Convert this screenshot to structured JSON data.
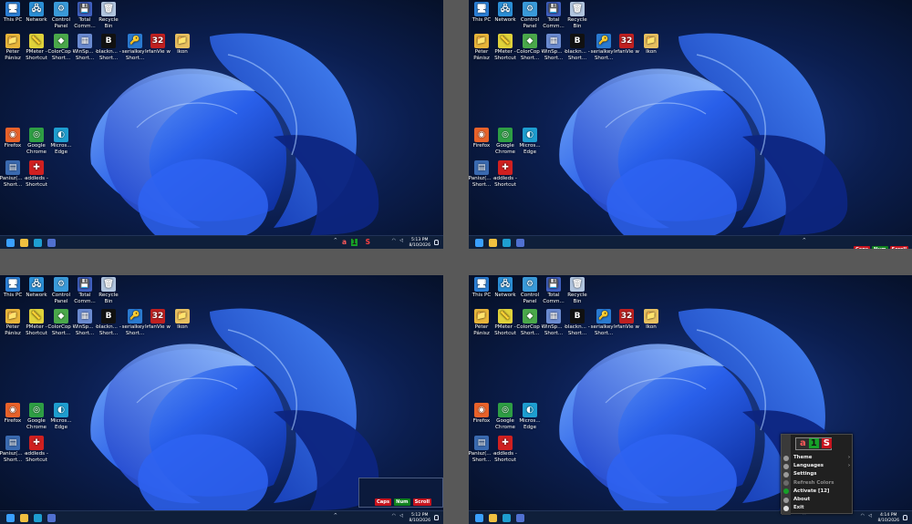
{
  "desktop": {
    "icons": [
      {
        "label": "This PC",
        "glyph": "🖥",
        "color": "#2b7fd6",
        "col": 0,
        "row": 0
      },
      {
        "label": "Network",
        "glyph": "🖧",
        "color": "#2b8fd6",
        "col": 1,
        "row": 0
      },
      {
        "label": "Control Panel",
        "glyph": "⚙",
        "color": "#3a9ad9",
        "col": 2,
        "row": 0
      },
      {
        "label": "Total Comm...",
        "glyph": "💾",
        "color": "#4060c0",
        "col": 3,
        "row": 0
      },
      {
        "label": "Recycle Bin",
        "glyph": "🗑",
        "color": "#b0c4de",
        "col": 4,
        "row": 0
      },
      {
        "label": "Péter Pánisz",
        "glyph": "📁",
        "color": "#e8b53a",
        "col": 0,
        "row": 1
      },
      {
        "label": "PMeter - Shortcut",
        "glyph": "📏",
        "color": "#e0d23a",
        "col": 1,
        "row": 1
      },
      {
        "label": "ColorCop - Short...",
        "glyph": "◆",
        "color": "#4aa84a",
        "col": 2,
        "row": 1
      },
      {
        "label": "WinSp... - Short...",
        "glyph": "▦",
        "color": "#6a8ad0",
        "col": 3,
        "row": 1
      },
      {
        "label": "blackn... - Short...",
        "glyph": "B",
        "color": "#111111",
        "col": 4,
        "row": 1
      },
      {
        "label": "serialkey - Short...",
        "glyph": "🔑",
        "color": "#2a7ad0",
        "col": 5,
        "row": 1
      },
      {
        "label": "IrfanVie w",
        "glyph": "32",
        "color": "#c02020",
        "col": 6,
        "row": 1
      },
      {
        "label": "Ikon",
        "glyph": "📁",
        "color": "#e8c060",
        "col": 7,
        "row": 1
      },
      {
        "label": "Firefox",
        "glyph": "◉",
        "color": "#e8622a",
        "col": 0,
        "row": 4
      },
      {
        "label": "Google Chrome",
        "glyph": "◎",
        "color": "#2e9e44",
        "col": 1,
        "row": 4
      },
      {
        "label": "Micros... Edge",
        "glyph": "◐",
        "color": "#1e9ed0",
        "col": 2,
        "row": 4
      },
      {
        "label": "Panisz(... - Short...",
        "glyph": "▤",
        "color": "#3a6ab0",
        "col": 0,
        "row": 5
      },
      {
        "label": "addleds - Shortcut",
        "glyph": "✚",
        "color": "#d02020",
        "col": 1,
        "row": 5
      }
    ],
    "icons_variant_labels": {
      "IrfanView_q2": "IrfanV... - Short..."
    }
  },
  "screens": [
    {
      "id": "q1",
      "clock_time": "5:13 PM",
      "clock_date": "8/10/2026",
      "tray_indicator": {
        "a": "a",
        "one": "1",
        "s": "S"
      }
    },
    {
      "id": "q2",
      "clock_time": "",
      "clock_date": "",
      "onscreen_keys": [
        "Caps",
        "Num",
        "Scroll"
      ]
    },
    {
      "id": "q3",
      "clock_time": "5:12 PM",
      "clock_date": "8/10/2026",
      "panel_keys": [
        "Caps",
        "Num",
        "Scroll"
      ]
    },
    {
      "id": "q4",
      "clock_time": "4:14 PM",
      "clock_date": "8/10/2026"
    }
  ],
  "context_menu": {
    "logo": {
      "a": "a",
      "one": "1",
      "s": "S"
    },
    "items": [
      {
        "label": "Theme",
        "submenu": true,
        "disabled": false
      },
      {
        "label": "Languages",
        "submenu": true,
        "disabled": false
      },
      {
        "label": "Settings",
        "submenu": false,
        "disabled": false
      },
      {
        "label": "Refresh Colors",
        "submenu": false,
        "disabled": true
      },
      {
        "label": "Activate [12]",
        "submenu": false,
        "disabled": false
      },
      {
        "label": "About",
        "submenu": false,
        "disabled": false
      },
      {
        "label": "Exit",
        "submenu": false,
        "disabled": false
      }
    ]
  },
  "colors": {
    "caps": "#c8141e",
    "num": "#10821e",
    "scroll": "#c8141e",
    "taskbar": "#0f1f3a",
    "desktop": "#08132e"
  },
  "taskbar_apps": [
    "windows-start-icon",
    "file-explorer-icon",
    "edge-icon",
    "floppy-app-icon"
  ],
  "tray_text": {
    "caret": "^",
    "wifi": "◠",
    "speaker": "◁"
  }
}
